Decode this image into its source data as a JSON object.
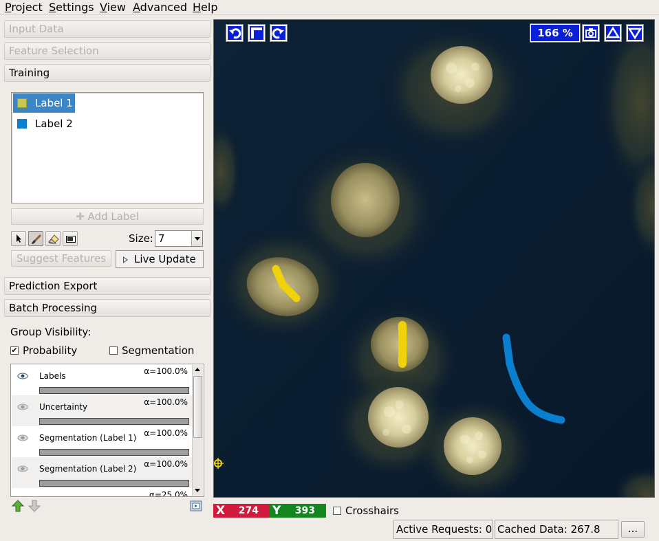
{
  "menu": [
    {
      "label": "Project"
    },
    {
      "label": "Settings"
    },
    {
      "label": "View"
    },
    {
      "label": "Advanced"
    },
    {
      "label": "Help"
    }
  ],
  "applets": {
    "input_data": "Input Data",
    "feature_selection": "Feature Selection",
    "training": "Training",
    "prediction_export": "Prediction Export",
    "batch_processing": "Batch Processing"
  },
  "labels": [
    {
      "name": "Label 1",
      "color": "#c8c850",
      "selected": true
    },
    {
      "name": "Label 2",
      "color": "#0a7fd0",
      "selected": false
    }
  ],
  "training": {
    "add_label": "Add Label",
    "size_label": "Size:",
    "size_value": "7",
    "suggest_features": "Suggest Features",
    "live_update": "Live Update",
    "tools": [
      "navigation-arrow-icon",
      "brush-icon",
      "eraser-icon",
      "box-select-icon"
    ],
    "active_tool": "brush-icon"
  },
  "group_visibility": {
    "title": "Group Visibility:",
    "probability": {
      "label": "Probability",
      "checked": true
    },
    "segmentation": {
      "label": "Segmentation",
      "checked": false
    }
  },
  "layers": [
    {
      "name": "Labels",
      "alpha": "α=100.0%",
      "opacity": 1.0,
      "visible": true
    },
    {
      "name": "Uncertainty",
      "alpha": "α=100.0%",
      "opacity": 1.0,
      "visible": false
    },
    {
      "name": "Segmentation (Label 1)",
      "alpha": "α=100.0%",
      "opacity": 1.0,
      "visible": false
    },
    {
      "name": "Segmentation (Label 2)",
      "alpha": "α=100.0%",
      "opacity": 1.0,
      "visible": false
    },
    {
      "name": "",
      "alpha": "α=25.0%",
      "opacity": 0.25,
      "visible": false
    }
  ],
  "viewer": {
    "zoom": "166 %",
    "buttons_left": [
      "undo-icon",
      "fit-view-icon",
      "redo-icon"
    ],
    "buttons_right": [
      "camera-icon",
      "up-icon",
      "down-icon"
    ],
    "annotation_colors": {
      "label1": "#f0d20a",
      "label2": "#0a7fd0"
    }
  },
  "coords": {
    "x_axis": "X",
    "x_value": "274",
    "x_color": "#d01b3c",
    "y_axis": "Y",
    "y_value": "393",
    "y_color": "#13861e"
  },
  "crosshairs": {
    "label": "Crosshairs",
    "checked": false
  },
  "status": {
    "active_requests": "Active Requests: 0",
    "cached_data": "Cached Data: 267.8 MB",
    "more": "..."
  }
}
